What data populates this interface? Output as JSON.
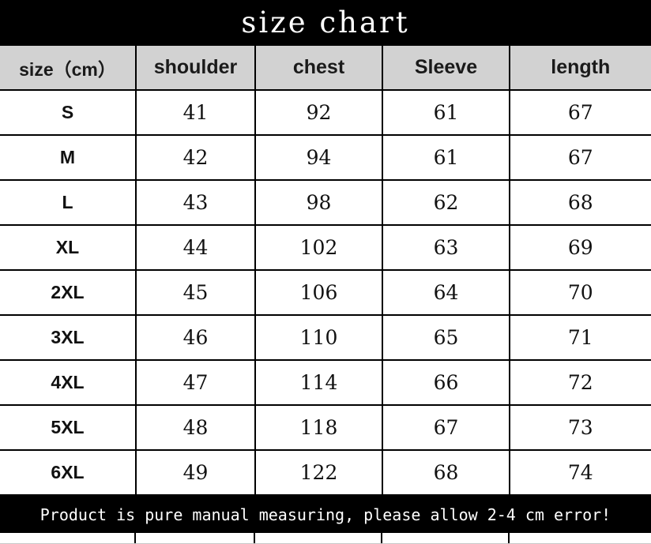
{
  "title": "size chart",
  "table": {
    "headers": [
      "size（cm）",
      "shoulder",
      "chest",
      "Sleeve",
      "length"
    ],
    "rows": [
      {
        "size": "S",
        "shoulder": "41",
        "chest": "92",
        "sleeve": "61",
        "length": "67"
      },
      {
        "size": "M",
        "shoulder": "42",
        "chest": "94",
        "sleeve": "61",
        "length": "67"
      },
      {
        "size": "L",
        "shoulder": "43",
        "chest": "98",
        "sleeve": "62",
        "length": "68"
      },
      {
        "size": "XL",
        "shoulder": "44",
        "chest": "102",
        "sleeve": "63",
        "length": "69"
      },
      {
        "size": "2XL",
        "shoulder": "45",
        "chest": "106",
        "sleeve": "64",
        "length": "70"
      },
      {
        "size": "3XL",
        "shoulder": "46",
        "chest": "110",
        "sleeve": "65",
        "length": "71"
      },
      {
        "size": "4XL",
        "shoulder": "47",
        "chest": "114",
        "sleeve": "66",
        "length": "72"
      },
      {
        "size": "5XL",
        "shoulder": "48",
        "chest": "118",
        "sleeve": "67",
        "length": "73"
      },
      {
        "size": "6XL",
        "shoulder": "49",
        "chest": "122",
        "sleeve": "68",
        "length": "74"
      }
    ]
  },
  "footer_note": "Product is pure manual measuring, please allow 2-4 cm error!",
  "colors": {
    "band_background": "#000000",
    "band_text": "#ffffff",
    "header_background": "#d2d2d2",
    "header_text": "#1a1a1a",
    "cell_background": "#ffffff",
    "cell_text": "#111111",
    "grid_line": "#000000"
  },
  "chart_data": {
    "type": "table",
    "title": "size chart",
    "columns": [
      "size（cm）",
      "shoulder",
      "chest",
      "Sleeve",
      "length"
    ],
    "unit": "cm",
    "categories": [
      "S",
      "M",
      "L",
      "XL",
      "2XL",
      "3XL",
      "4XL",
      "5XL",
      "6XL"
    ],
    "series": [
      {
        "name": "shoulder",
        "values": [
          41,
          42,
          43,
          44,
          45,
          46,
          47,
          48,
          49
        ]
      },
      {
        "name": "chest",
        "values": [
          92,
          94,
          98,
          102,
          106,
          110,
          114,
          118,
          122
        ]
      },
      {
        "name": "Sleeve",
        "values": [
          61,
          61,
          62,
          63,
          64,
          65,
          66,
          67,
          68
        ]
      },
      {
        "name": "length",
        "values": [
          67,
          67,
          68,
          69,
          70,
          71,
          72,
          73,
          74
        ]
      }
    ],
    "annotation": "Product is pure manual measuring, please allow 2-4 cm error!"
  }
}
